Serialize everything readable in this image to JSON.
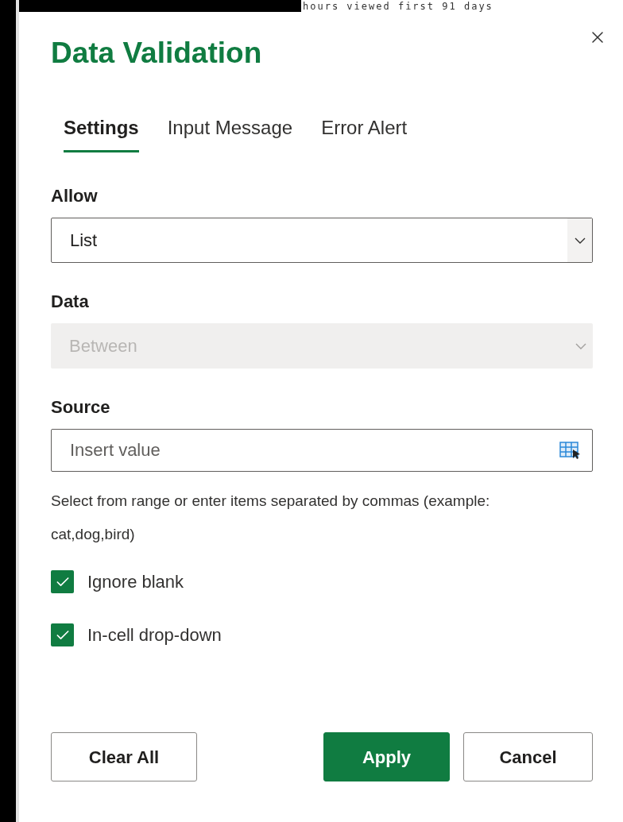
{
  "background": {
    "text": "hours viewed first 91 days"
  },
  "dialog": {
    "title": "Data Validation",
    "tabs": [
      {
        "label": "Settings",
        "selected": true
      },
      {
        "label": "Input Message",
        "selected": false
      },
      {
        "label": "Error Alert",
        "selected": false
      }
    ],
    "selects": [
      {
        "label": "Allow",
        "value": "List",
        "disabled": false
      },
      {
        "label": "Data",
        "value": "Between",
        "disabled": true
      }
    ],
    "source": {
      "label": "Source",
      "placeholder": "Insert value"
    },
    "help": "Select from range or enter items separated by commas (example: cat,dog,bird)",
    "checkboxes": [
      {
        "label": "Ignore blank",
        "checked": true
      },
      {
        "label": "In-cell drop-down",
        "checked": true
      }
    ],
    "buttons": [
      {
        "label": "Clear All",
        "kind": "secondary"
      },
      {
        "label": "Apply",
        "kind": "primary"
      },
      {
        "label": "Cancel",
        "kind": "secondary"
      }
    ]
  }
}
